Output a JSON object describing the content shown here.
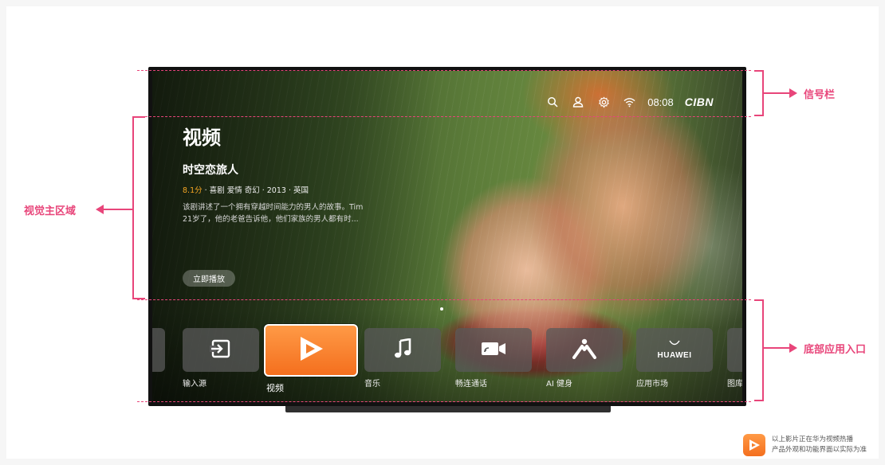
{
  "status_bar": {
    "time": "08:08",
    "brand": "CIBN",
    "icons": [
      "search-icon",
      "user-icon",
      "settings-icon",
      "wifi-icon"
    ]
  },
  "hero": {
    "section_title": "视频",
    "movie_title": "时空恋旅人",
    "score": "8.1分",
    "meta": " · 喜剧  爱情  奇幻 · 2013 · 英国",
    "description_line1": "该剧讲述了一个拥有穿越时间能力的男人的故事。Tim",
    "description_line2": "21岁了，他的老爸告诉他，他们家族的男人都有时...",
    "play_label": "立即播放"
  },
  "apps": [
    {
      "label": "输入源",
      "icon": "input-source-icon"
    },
    {
      "label": "视频",
      "icon": "video-play-icon",
      "active": true
    },
    {
      "label": "音乐",
      "icon": "music-note-icon"
    },
    {
      "label": "畅连通话",
      "icon": "video-call-icon"
    },
    {
      "label": "AI 健身",
      "icon": "ai-fitness-icon"
    },
    {
      "label": "应用市场",
      "icon": "huawei-logo-icon",
      "logo_text": "HUAWEI"
    },
    {
      "label": "图库",
      "icon": "gallery-icon"
    }
  ],
  "annotations": {
    "signal_bar": "信号栏",
    "visual_main": "视觉主区域",
    "bottom_entry": "底部应用入口",
    "accent_color": "#e8457a"
  },
  "footer_note": {
    "line1": "以上影片正在华为视频热播",
    "line2": "产品外观和功能界面以实际为准"
  }
}
